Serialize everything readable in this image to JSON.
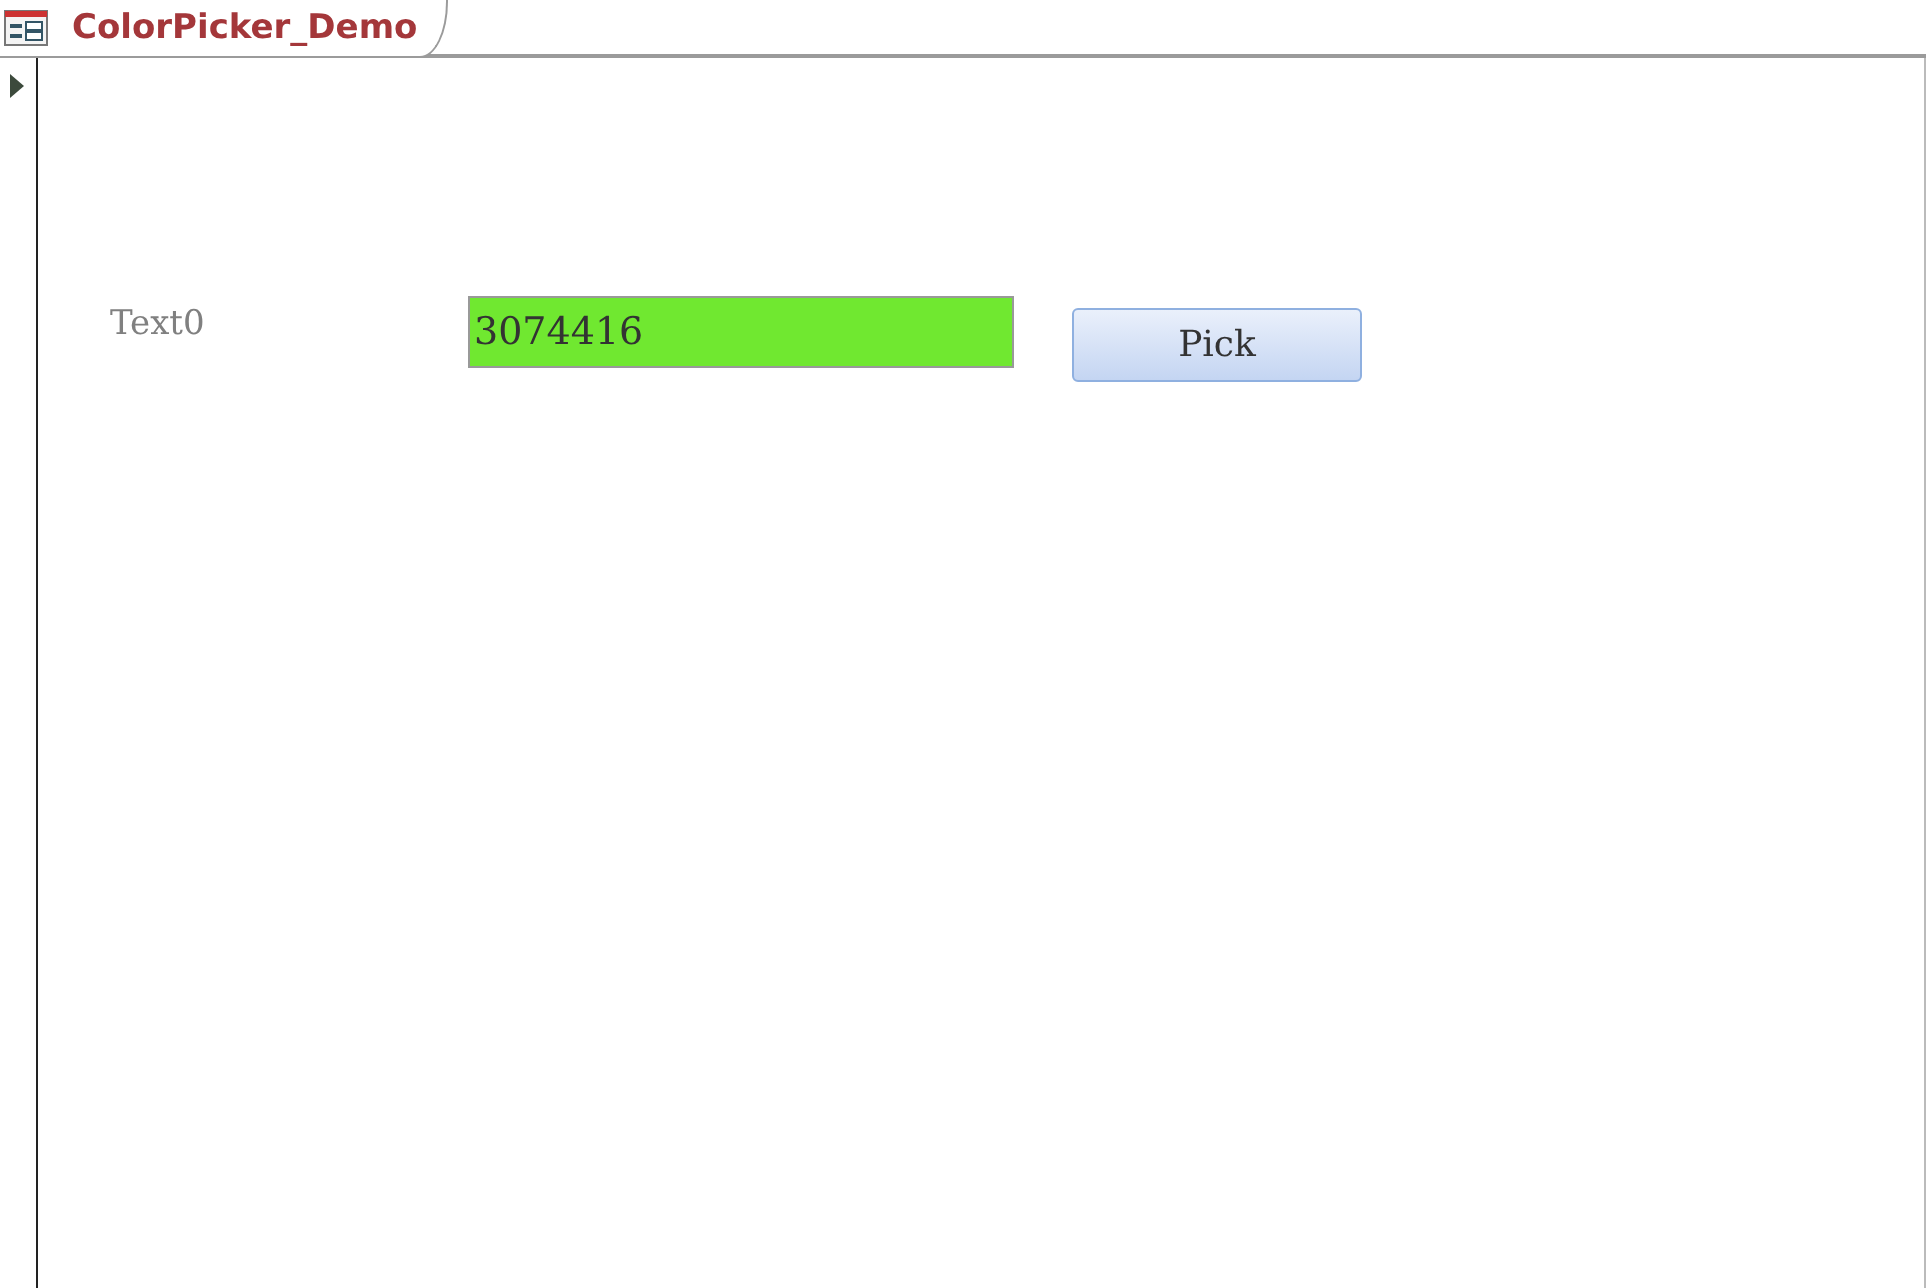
{
  "tab": {
    "title": "ColorPicker_Demo"
  },
  "form": {
    "label": "Text0",
    "field": {
      "value": "3074416",
      "color": "#70e830"
    },
    "button": "Pick"
  }
}
